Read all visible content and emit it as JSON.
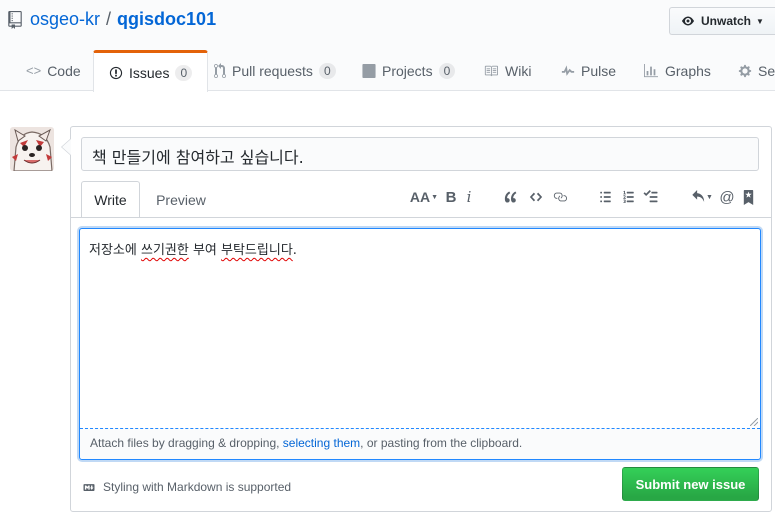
{
  "repo": {
    "owner": "osgeo-kr",
    "separator": "/",
    "name": "qgisdoc101"
  },
  "watch_button": {
    "label": "Unwatch"
  },
  "tabs": [
    {
      "label": "Code",
      "icon": "code-icon"
    },
    {
      "label": "Issues",
      "count": "0",
      "icon": "issue-opened-icon",
      "selected": true
    },
    {
      "label": "Pull requests",
      "count": "0",
      "icon": "git-pull-request-icon"
    },
    {
      "label": "Projects",
      "count": "0",
      "icon": "project-icon"
    },
    {
      "label": "Wiki",
      "icon": "book-icon"
    },
    {
      "label": "Pulse",
      "icon": "pulse-icon"
    },
    {
      "label": "Graphs",
      "icon": "graph-icon"
    },
    {
      "label": "Set",
      "icon": "gear-icon"
    }
  ],
  "issue_form": {
    "title_value": "책 만들기에 참여하고 싶습니다.",
    "write_tab": "Write",
    "preview_tab": "Preview",
    "toolbar": {
      "heading": "AA",
      "bold": "B",
      "italic": "i",
      "mention": "@"
    },
    "body": {
      "segments": [
        "저장소에 ",
        "쓰기권한",
        " 부여 ",
        "부탁드립니다",
        "."
      ]
    },
    "attach": {
      "prefix": "Attach files by dragging & dropping, ",
      "link": "selecting them",
      "suffix": ", or pasting from the clipboard."
    },
    "markdown_note": "Styling with Markdown is supported",
    "submit_label": "Submit new issue"
  },
  "colors": {
    "link": "#0366d6",
    "selected_tab_accent": "#e36209",
    "submit_green": "#28a745",
    "focus_blue": "#2188ff"
  }
}
